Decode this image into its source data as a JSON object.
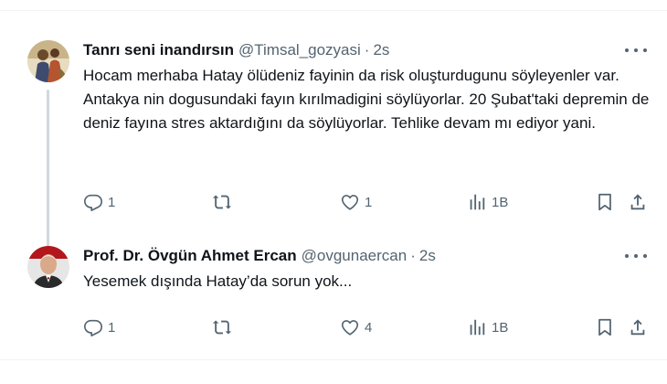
{
  "tweets": [
    {
      "author_name": "Tanrı seni inandırsın",
      "handle": "@Timsal_gozyasi",
      "separator": "·",
      "time": "2s",
      "text": "Hocam merhaba Hatay ölüdeniz fayinin da risk oluşturdugunu söyleyenler var. Antakya nin dogusundaki fayın kırılmadigini söylüyorlar. 20 Şubat'taki depremin de deniz fayına stres aktardığını da söylüyorlar. Tehlike devam mı ediyor yani.",
      "reply_count": "1",
      "retweet_count": "",
      "like_count": "1",
      "view_count": "1B",
      "icons": [
        "avatar-illustration",
        "more-icon",
        "reply-icon",
        "retweet-icon",
        "like-icon",
        "views-icon",
        "bookmark-icon",
        "share-icon"
      ]
    },
    {
      "author_name": "Prof. Dr. Övgün Ahmet Ercan",
      "handle": "@ovgunaercan",
      "separator": "·",
      "time": "2s",
      "text": "Yesemek dışında Hatay’da sorun yok...",
      "reply_count": "1",
      "retweet_count": "",
      "like_count": "4",
      "view_count": "1B",
      "icons": [
        "avatar-photo",
        "more-icon",
        "reply-icon",
        "retweet-icon",
        "like-icon",
        "views-icon",
        "bookmark-icon",
        "share-icon"
      ]
    }
  ],
  "colors": {
    "text_primary": "#0f1419",
    "text_secondary": "#536471",
    "divider": "#eff3f4",
    "thread_line": "#cfd9de"
  }
}
